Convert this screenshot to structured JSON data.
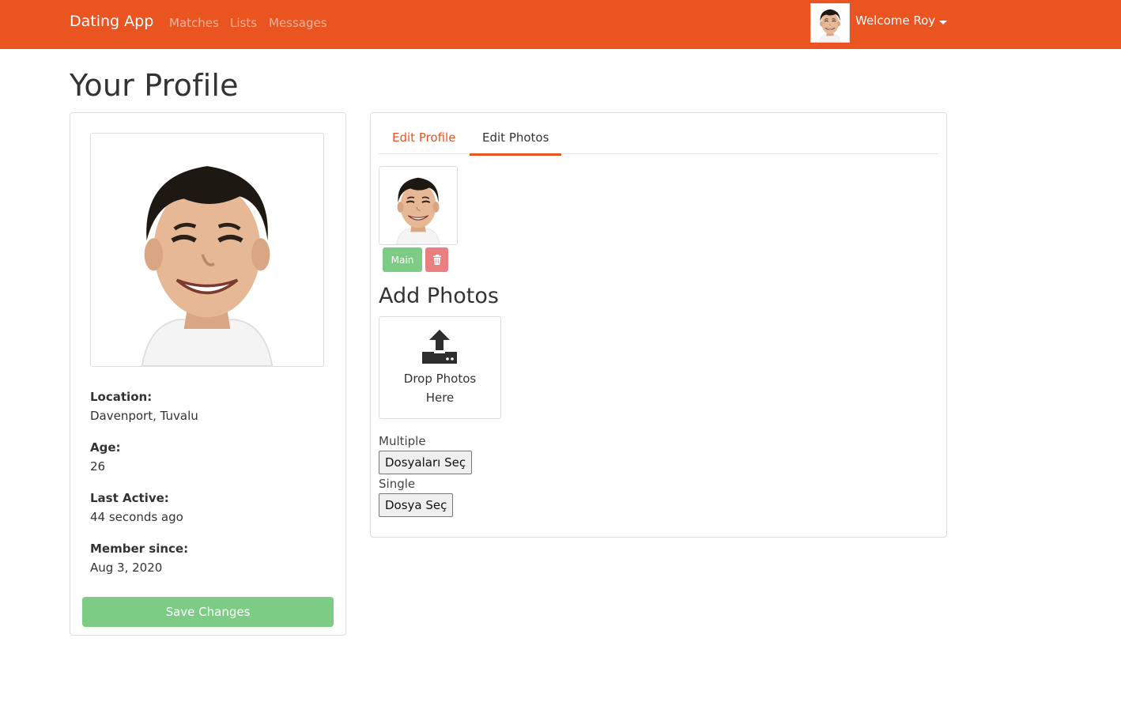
{
  "navbar": {
    "brand": "Dating App",
    "links": [
      "Matches",
      "Lists",
      "Messages"
    ],
    "welcome": "Welcome Roy",
    "accent_color": "#e95420"
  },
  "page": {
    "title": "Your Profile"
  },
  "profile": {
    "location_label": "Location:",
    "location_value": "Davenport, Tuvalu",
    "age_label": "Age:",
    "age_value": "26",
    "last_active_label": "Last Active:",
    "last_active_value": "44 seconds ago",
    "member_since_label": "Member since:",
    "member_since_value": "Aug 3, 2020",
    "save_button": "Save Changes"
  },
  "tabs": {
    "edit_profile": "Edit Profile",
    "edit_photos": "Edit Photos",
    "active": "Edit Photos"
  },
  "photos": {
    "main_button": "Main",
    "delete_icon": "trash-icon",
    "add_title": "Add Photos",
    "drop_text_line1": "Drop Photos",
    "drop_text_line2": "Here",
    "upload_icon": "upload-icon",
    "multiple_label": "Multiple",
    "multiple_button": "Dosyaları Seç",
    "single_label": "Single",
    "single_button": "Dosya Seç"
  },
  "colors": {
    "success": "#7dcc86",
    "danger": "#ea7f7f"
  }
}
